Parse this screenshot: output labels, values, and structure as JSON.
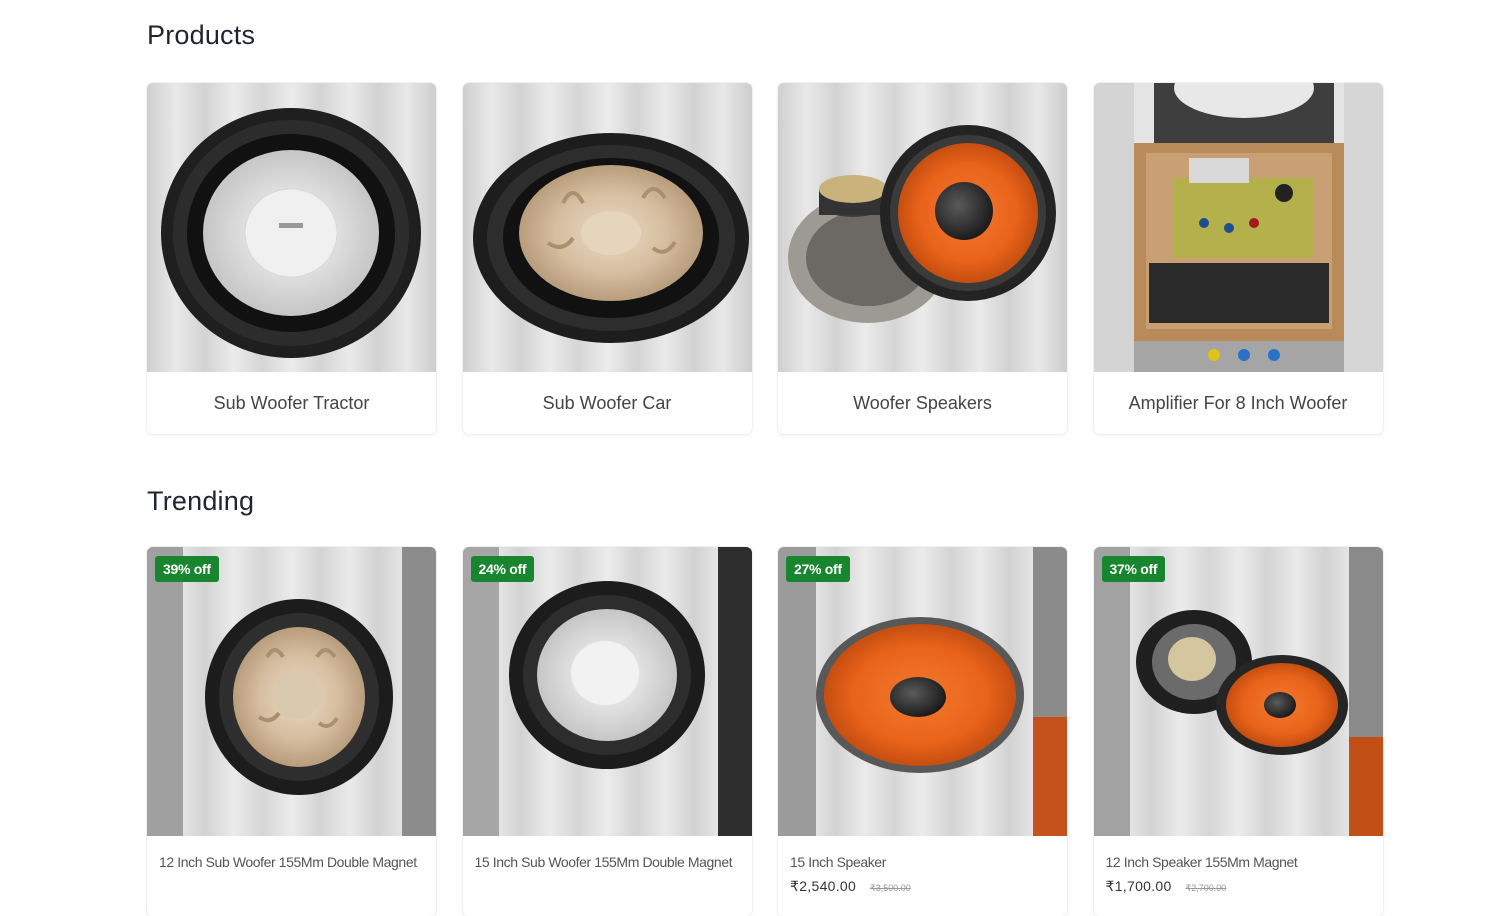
{
  "products": {
    "title": "Products",
    "items": [
      {
        "label": "Sub Woofer Tractor"
      },
      {
        "label": "Sub Woofer Car"
      },
      {
        "label": "Woofer Speakers"
      },
      {
        "label": "Amplifier For 8 Inch Woofer"
      }
    ]
  },
  "trending": {
    "title": "Trending",
    "items": [
      {
        "badge": "39% off",
        "name": "12 Inch Sub Woofer 155Mm Double Magnet",
        "price": "",
        "mrp": ""
      },
      {
        "badge": "24% off",
        "name": "15 Inch Sub Woofer 155Mm Double Magnet",
        "price": "",
        "mrp": ""
      },
      {
        "badge": "27% off",
        "name": "15 Inch Speaker",
        "price": "₹2,540.00",
        "mrp": "₹3,500.00"
      },
      {
        "badge": "37% off",
        "name": "12 Inch Speaker 155Mm Magnet",
        "price": "₹1,700.00",
        "mrp": "₹2,700.00"
      }
    ]
  },
  "colors": {
    "badge": "#18862f",
    "orange_cone": "#e8621a",
    "champagne_cone": "#d9c2a4",
    "silver_cone": "#e6e6e6"
  }
}
